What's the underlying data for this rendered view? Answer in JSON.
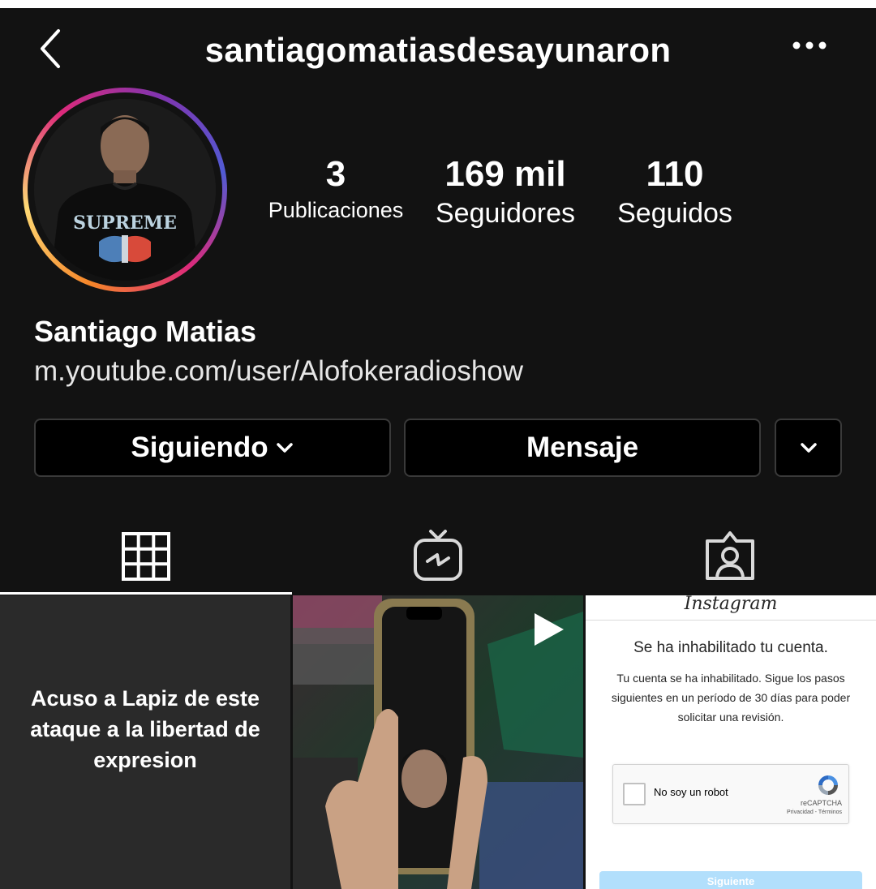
{
  "header": {
    "username": "santiagomatiasdesayunaron",
    "back_icon": "chevron-left-icon",
    "more_icon": "more-horizontal-icon"
  },
  "profile": {
    "avatar_icon": "profile-photo",
    "stats": {
      "posts_count": "3",
      "posts_label": "Publicaciones",
      "followers_count": "169 mil",
      "followers_label": "Seguidores",
      "following_count": "110",
      "following_label": "Seguidos"
    },
    "full_name": "Santiago Matias",
    "bio_link": "m.youtube.com/user/Alofokeradioshow"
  },
  "actions": {
    "following_label": "Siguiendo",
    "message_label": "Mensaje"
  },
  "tabs": [
    {
      "name": "grid",
      "icon": "grid-icon",
      "active": true
    },
    {
      "name": "igtv",
      "icon": "igtv-icon",
      "active": false
    },
    {
      "name": "tagged",
      "icon": "tagged-person-icon",
      "active": false
    }
  ],
  "posts": {
    "post1_text": "Acuso a Lapiz de este ataque a la libertad de expresion",
    "post2_type": "video",
    "post3": {
      "logo_text": "Instagram",
      "title": "Se ha inhabilitado tu cuenta.",
      "body": "Tu cuenta se ha inhabilitado. Sigue los pasos siguientes en un período de 30 días para poder solicitar una revisión.",
      "captcha_label": "No soy un robot",
      "captcha_brand": "reCAPTCHA",
      "captcha_links": "Privacidad - Términos",
      "button_label": "Siguiente"
    }
  },
  "colors": {
    "background": "#121212",
    "ring_gradient": [
      "#f58529",
      "#dd2a7b",
      "#8134af"
    ],
    "button_border": "#3a3a3a",
    "next_button": "#b2dffc"
  }
}
